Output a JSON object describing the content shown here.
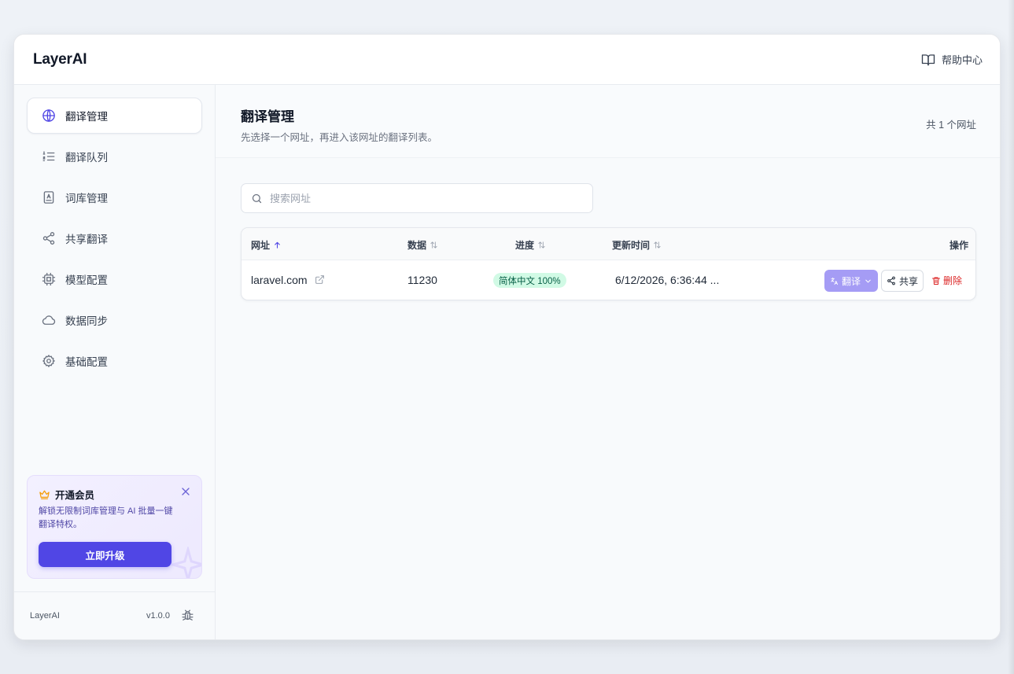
{
  "header": {
    "brand": "LayerAI",
    "help_label": "帮助中心"
  },
  "sidebar": {
    "items": [
      {
        "label": "翻译管理",
        "icon": "globe-icon",
        "active": true
      },
      {
        "label": "翻译队列",
        "icon": "list-ordered-icon",
        "active": false
      },
      {
        "label": "词库管理",
        "icon": "book-icon",
        "active": false
      },
      {
        "label": "共享翻译",
        "icon": "share-icon",
        "active": false
      },
      {
        "label": "模型配置",
        "icon": "chip-icon",
        "active": false
      },
      {
        "label": "数据同步",
        "icon": "cloud-icon",
        "active": false
      },
      {
        "label": "基础配置",
        "icon": "gear-icon",
        "active": false
      }
    ],
    "promo": {
      "title": "开通会员",
      "description": "解锁无限制词库管理与 AI 批量一键翻译特权。",
      "button": "立即升级"
    },
    "footer": {
      "brand": "LayerAI",
      "version": "v1.0.0"
    }
  },
  "main": {
    "title": "翻译管理",
    "subtitle": "先选择一个网址，再进入该网址的翻译列表。",
    "count": "共 1 个网址",
    "search": {
      "placeholder": "搜索网址",
      "value": ""
    },
    "table": {
      "columns": [
        "网址",
        "数据",
        "进度",
        "更新时间",
        "操作"
      ],
      "rows": [
        {
          "url": "laravel.com",
          "data": "11230",
          "progress": "简体中文 100%",
          "updated": "6/12/2026, 6:36:44 ...",
          "actions": {
            "translate": "翻译",
            "share": "共享",
            "delete": "删除"
          }
        }
      ]
    }
  },
  "colors": {
    "accent": "#5046e5",
    "translate_button": "#a59cf5",
    "progress_badge_bg": "#d1fae5",
    "delete": "#dc2626"
  }
}
